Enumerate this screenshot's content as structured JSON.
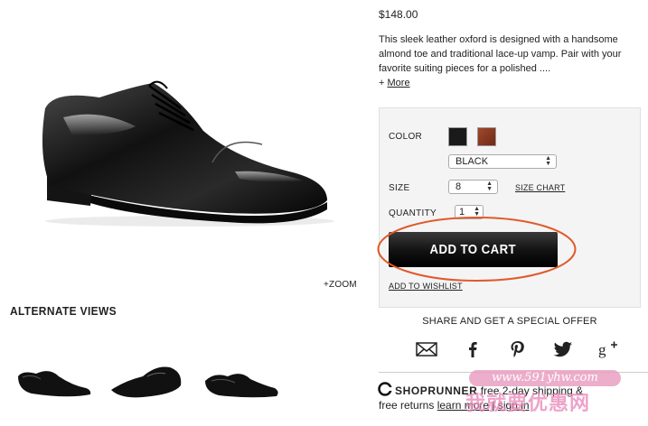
{
  "product": {
    "price": "$148.00",
    "description": "This sleek leather oxford is designed with a handsome almond toe and traditional lace-up vamp. Pair with your favorite suiting pieces for a polished ....",
    "more_prefix": "+",
    "more_label": "More",
    "zoom_label": "+ZOOM"
  },
  "alternate_views": {
    "title": "ALTERNATE VIEWS"
  },
  "options": {
    "color_label": "COLOR",
    "color_value": "BLACK",
    "swatches": [
      "#1a1a1a",
      "#8a3a22"
    ],
    "size_label": "SIZE",
    "size_value": "8",
    "size_chart_label": "SIZE CHART",
    "quantity_label": "QUANTITY",
    "quantity_value": "1",
    "add_to_cart_label": "ADD TO CART",
    "wishlist_label": "ADD TO WISHLIST",
    "highlight_color": "#e05a2b"
  },
  "share": {
    "title": "SHARE AND GET A SPECIAL OFFER",
    "icons": [
      "email-icon",
      "facebook-icon",
      "pinterest-icon",
      "twitter-icon",
      "google-plus-icon"
    ]
  },
  "shoprunner": {
    "brand": "SHOPRUNNER",
    "text_1": "free 2-day shipping &",
    "text_2": "free returns",
    "learn_more": "learn more",
    "separator": "|",
    "sign_in": "sign in"
  },
  "watermark": {
    "url": "www.591yhw.com",
    "text": "我就要优惠网"
  }
}
